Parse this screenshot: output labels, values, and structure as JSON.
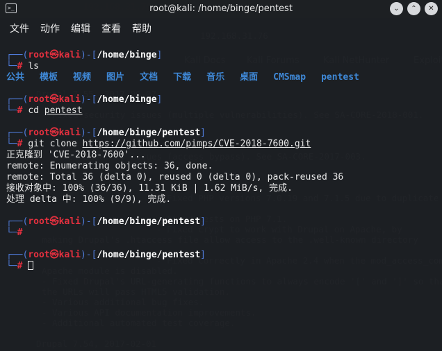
{
  "window": {
    "title": "root@kali: /home/binge/pentest",
    "icon": "terminal-icon",
    "controls": [
      "minimize-icon",
      "maximize-icon",
      "close-icon"
    ]
  },
  "menu": [
    "文件",
    "动作",
    "编辑",
    "查看",
    "帮助"
  ],
  "background": {
    "url_text": "192.168.31.76",
    "tabs": [
      "Kali Docs",
      "Kali Forums",
      "Kali NetHunter",
      "Exploit"
    ],
    "lines": [
      "Drupal 7.55, 2017-06-07",
      "- Fixed security issues (multiple vulnerabilities). See SA-CORE-2018-001.",
      "- Fixed security issues (access bypass). See SA-CORE-2017-003.",
      "- Fixed PHP versions 7.0.19 and 7.1.5 due to duplicate",
      "- Fixed tests on PHP 7.1.",
      "- Fixed crypt to work with Drupal on Apache, by",
      "  making Drupal's .htaccess file allow access to the .well-known directory",
      "- Fixed correctly in Apache 2.4 when the mod_access_compat",
      "  Apache module is disabled.",
      "- Fixed Drupal's URL-generating functions to always encode '[' and ']' so that",
      "  the URLs will pass HTML5 validation.",
      "- Various additional bug fixes.",
      "- Various API documentation improvements.",
      "- Additional automated test coverage.",
      "Drupal 7.54, 2017-02-01"
    ]
  },
  "prompt": {
    "user": "root",
    "host": "kali",
    "symbol": "#"
  },
  "commands": [
    {
      "path": "/home/binge",
      "command": "ls"
    },
    {
      "path": "/home/binge",
      "command_pre": "cd ",
      "command_arg": "pentest"
    },
    {
      "path": "/home/binge/pentest",
      "command_pre": "git clone ",
      "command_arg": "https://github.com/pimps/CVE-2018-7600.git"
    },
    {
      "path": "/home/binge/pentest"
    },
    {
      "path": "/home/binge/pentest"
    }
  ],
  "ls_output": [
    "公共",
    "模板",
    "视频",
    "图片",
    "文档",
    "下载",
    "音乐",
    "桌面",
    "CMSmap",
    "pentest"
  ],
  "clone_output": [
    "正克隆到 'CVE-2018-7600'...",
    "remote: Enumerating objects: 36, done.",
    "remote: Total 36 (delta 0), reused 0 (delta 0), pack-reused 36",
    "接收对象中: 100% (36/36), 11.31 KiB | 1.62 MiB/s, 完成.",
    "处理 delta 中: 100% (9/9), 完成."
  ],
  "colors": {
    "prompt_frame": "#4f7bd9",
    "prompt_user": "#e5303f",
    "directory": "#3f88d6"
  }
}
